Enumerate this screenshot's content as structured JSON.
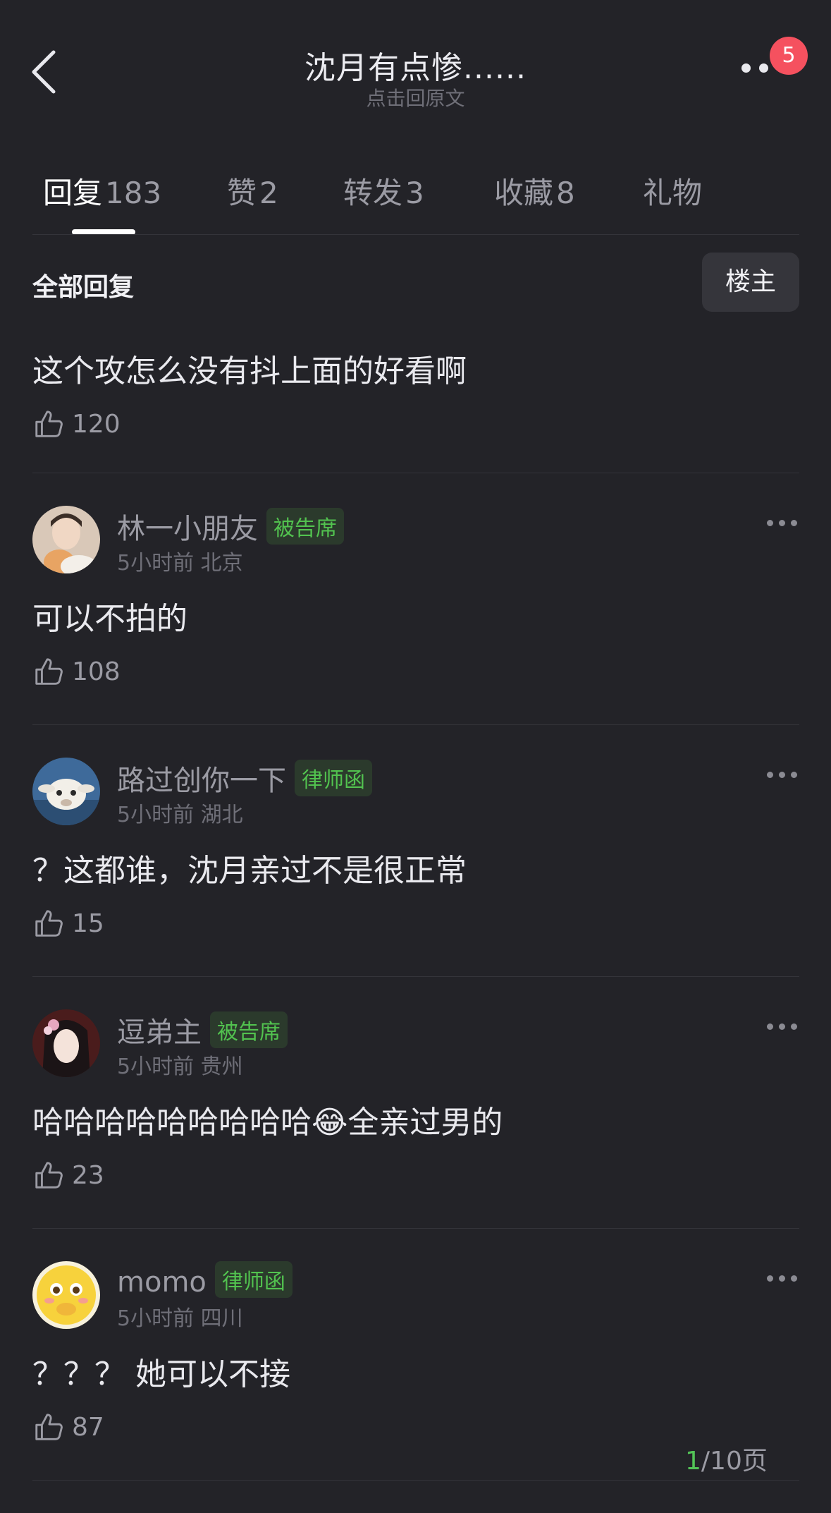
{
  "header": {
    "title": "沈月有点惨......",
    "subtitle": "点击回原文",
    "notification_count": "5"
  },
  "tabs": [
    {
      "label": "回复",
      "count": "183"
    },
    {
      "label": "赞",
      "count": "2"
    },
    {
      "label": "转发",
      "count": "3"
    },
    {
      "label": "收藏",
      "count": "8"
    },
    {
      "label": "礼物",
      "count": ""
    }
  ],
  "section": {
    "title": "全部回复",
    "owner_button": "楼主"
  },
  "first_post": {
    "text": "这个攻怎么没有抖上面的好看啊",
    "likes": "120"
  },
  "comments": [
    {
      "username": "林一小朋友",
      "tag": "被告席",
      "time": "5小时前",
      "location": "北京",
      "text": "可以不拍的",
      "likes": "108"
    },
    {
      "username": "路过创你一下",
      "tag": "律师函",
      "time": "5小时前",
      "location": "湖北",
      "text": "？这都谁，沈月亲过不是很正常",
      "likes": "15"
    },
    {
      "username": "逗弟主",
      "tag": "被告席",
      "time": "5小时前",
      "location": "贵州",
      "text": "哈哈哈哈哈哈哈哈哈😂全亲过男的",
      "likes": "23"
    },
    {
      "username": "momo",
      "tag": "律师函",
      "time": "5小时前",
      "location": "四川",
      "text": "？？？ 她可以不接",
      "likes": "87"
    }
  ],
  "pagination": {
    "current": "1",
    "total": "/10页"
  },
  "colors": {
    "background": "#232328",
    "tag_text": "#52c24f",
    "badge": "#f5515f"
  }
}
